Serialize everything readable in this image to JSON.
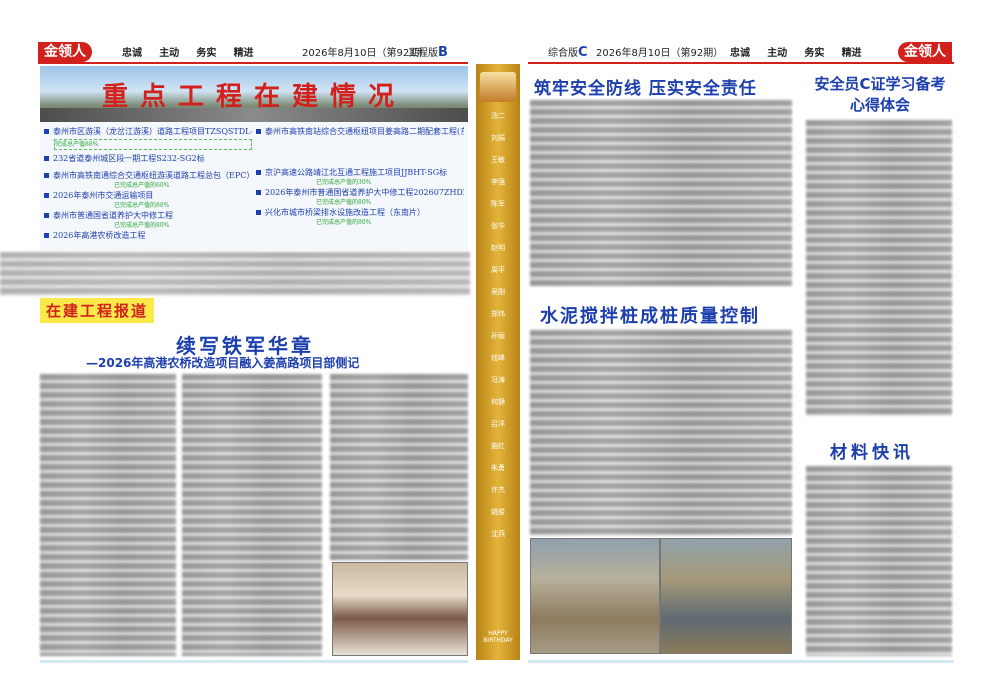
{
  "left_page": {
    "brand": "金领人",
    "motto": [
      "忠诚",
      "主动",
      "务实",
      "精进"
    ],
    "date_issue": "2026年8月10日（第92期）",
    "edition": "工程版",
    "edition_letter": "B",
    "banner_title": "重点工程在建情况",
    "projects_col1": [
      {
        "name": "泰州市区游溪（龙岔江游溪）道路工程项目TZSQSTDL-EPC标段设计施工总承包",
        "progress": "完成总产值88%"
      },
      {
        "name": "232省道泰州城区段一期工程S232-SG2标",
        "progress": ""
      },
      {
        "name": "泰州市高铁南通综合交通枢纽游溪道路工程总包（EPC）",
        "progress": "已完成总产值的60%"
      },
      {
        "name": "2026年泰州市交通运输项目",
        "progress": "已完成总产值的88%"
      },
      {
        "name": "泰州市普通国省道养护大中修工程",
        "progress": "已完成总产值的80%"
      },
      {
        "name": "2026年高港农桥改造工程",
        "progress": ""
      }
    ],
    "projects_col2": [
      {
        "name": "泰州市高铁南站综合交通枢纽项目姜高路二期配套工程(东风路-泰顺路)",
        "progress": ""
      },
      {
        "name": "京沪高速公路靖江北互通工程施工项目JJBHT-SG标",
        "progress": "已完成总产值的30%"
      },
      {
        "name": "2026年泰州市普通国省道养护大中修工程202607ZHDZX-SG三标",
        "progress": "已完成总产值的80%"
      },
      {
        "name": "兴化市城市桥梁排水设施改造工程（东南片）",
        "progress": "已完成总产值的80%"
      }
    ],
    "report_tag": "在建工程报道",
    "article_title": "续写铁军华章",
    "article_subtitle": "—2026年高港农桥改造项目融入姜高路项目部侧记"
  },
  "spine": {
    "birthday_text": "HAPPY BIRTHDAY",
    "names": [
      "汤二",
      "刘娟",
      "王敏",
      "李强",
      "陈军",
      "张华",
      "赵明",
      "周平",
      "吴刚",
      "郑伟",
      "孙丽",
      "钱峰",
      "冯涛",
      "何静",
      "吕洋",
      "施红",
      "朱勇",
      "许杰",
      "姚俊",
      "沈燕"
    ]
  },
  "right_page": {
    "edition": "综合版",
    "edition_letter": "C",
    "date_issue": "2026年8月10日（第92期）",
    "motto": [
      "忠诚",
      "主动",
      "务实",
      "精进"
    ],
    "brand": "金领人",
    "headline1": "筑牢安全防线 压实安全责任",
    "headline2": "安全员C证学习备考心得体会",
    "headline3": "水泥搅拌桩成桩质量控制",
    "headline4": "材料快讯"
  },
  "colors": {
    "brand_red": "#d2201c",
    "headline_blue": "#1d3fae",
    "spine_gold": "#d6a21e",
    "progress_green": "#2aa83a"
  }
}
